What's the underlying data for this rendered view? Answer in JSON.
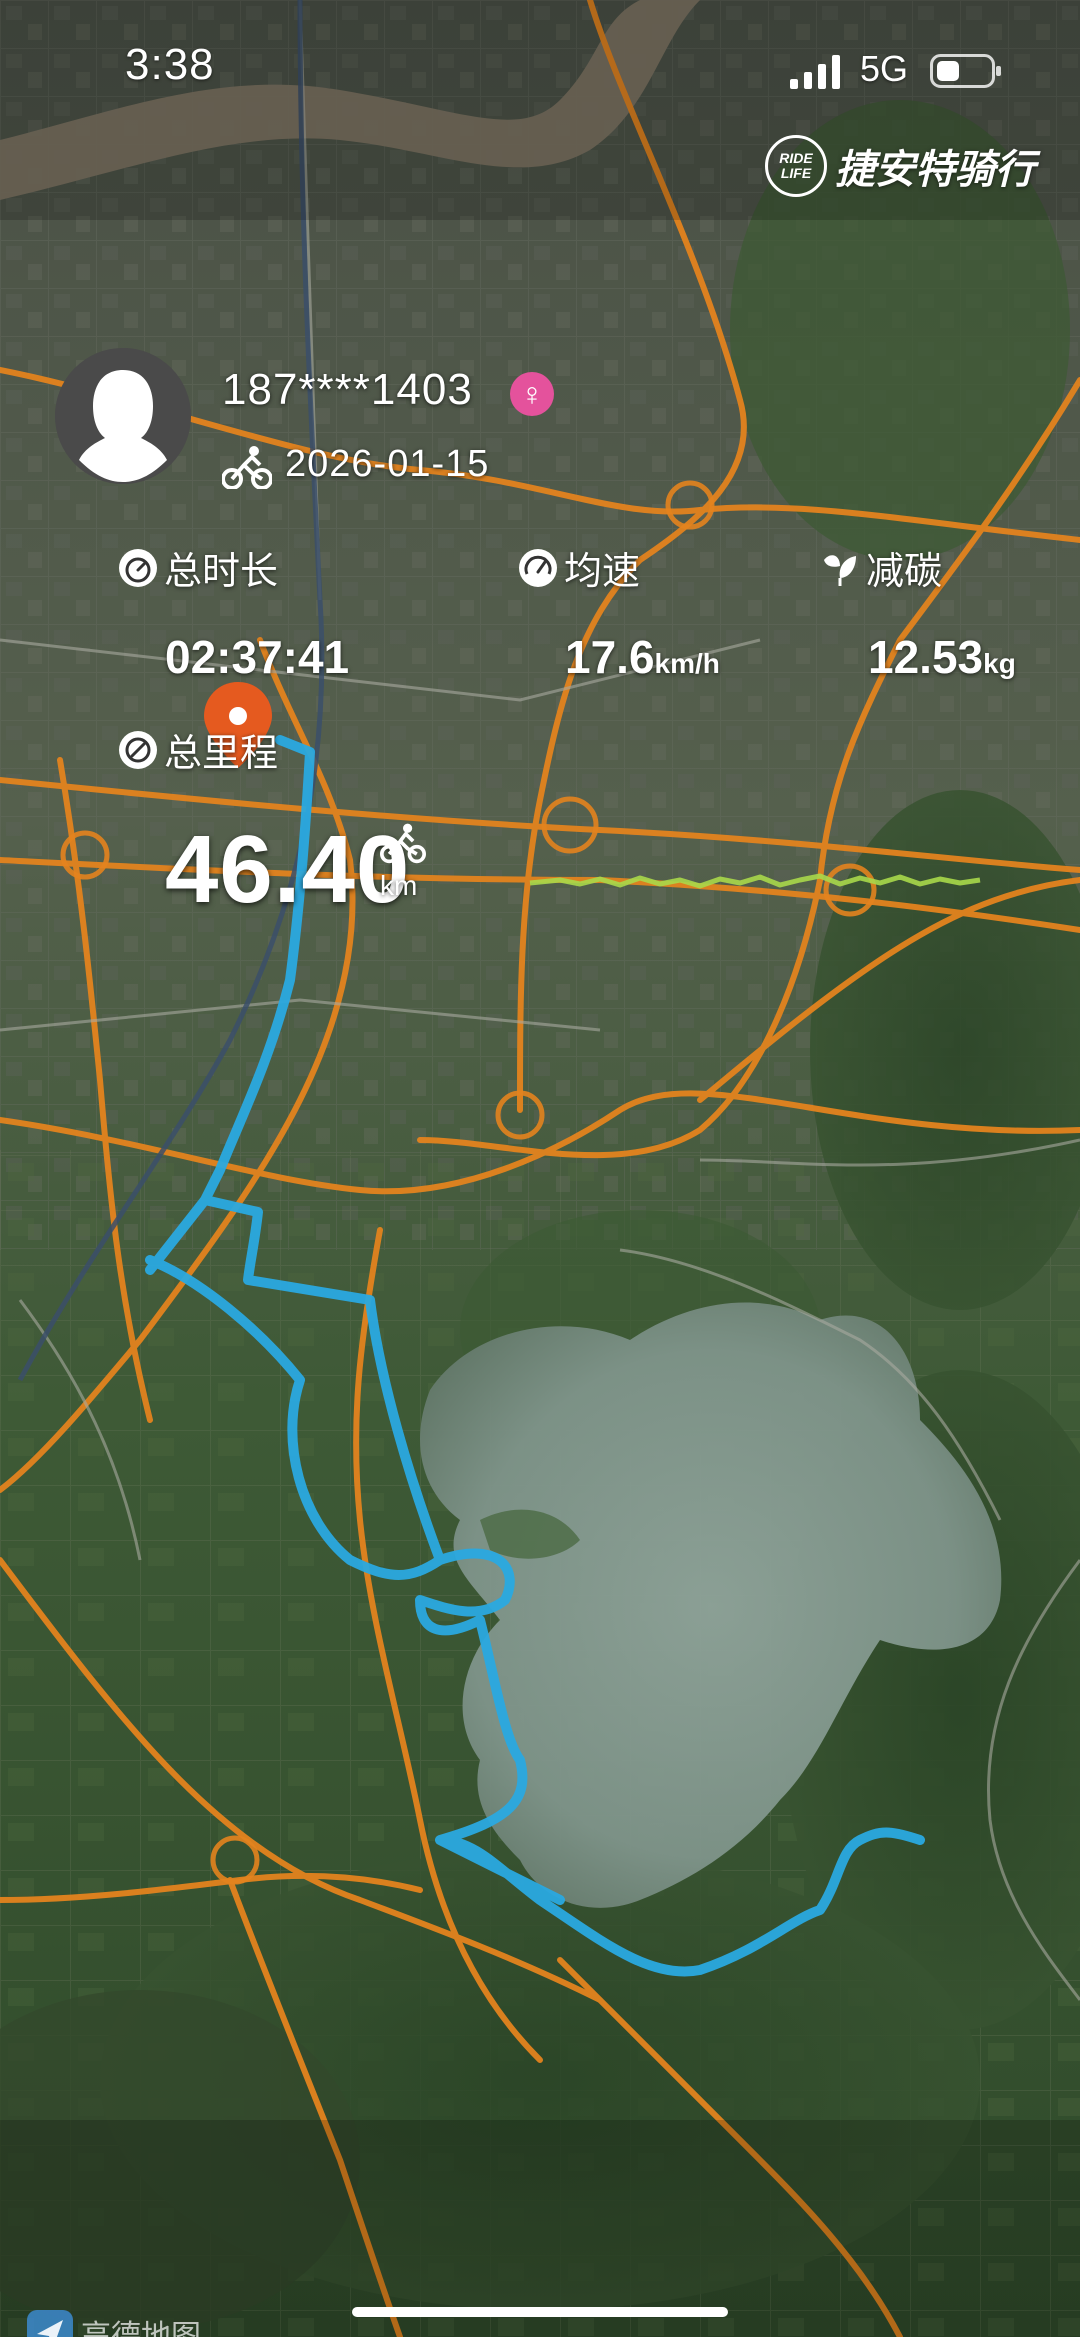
{
  "status_bar": {
    "time": "3:38",
    "network": "5G"
  },
  "brand": {
    "badge_top": "RIDE",
    "badge_bottom": "LIFE",
    "name": "捷安特骑行"
  },
  "user": {
    "phone": "187****1403",
    "gender_symbol": "♀",
    "ride_date": "2026-01-15"
  },
  "stats": {
    "duration_label": "总时长",
    "duration_value": "02:37:41",
    "speed_label": "均速",
    "speed_value": "17.6",
    "speed_unit": "km/h",
    "carbon_label": "减碳",
    "carbon_value": "12.53",
    "carbon_unit": "kg",
    "distance_label": "总里程",
    "distance_value": "46.40",
    "distance_unit": "km"
  },
  "map": {
    "provider": "高德地图",
    "route_color": "#2aa9e0",
    "road_color": "#e3831e",
    "speed_line_color": "#a8d84a"
  },
  "icons": {
    "signal": "signal-bars-icon",
    "battery": "battery-icon",
    "gender": "female-icon",
    "ride": "cyclist-icon",
    "duration": "stopwatch-icon",
    "speed": "speedometer-icon",
    "carbon": "leaf-icon",
    "distance": "distance-icon",
    "pin": "start-pin-icon",
    "map_logo": "amap-logo-icon"
  }
}
